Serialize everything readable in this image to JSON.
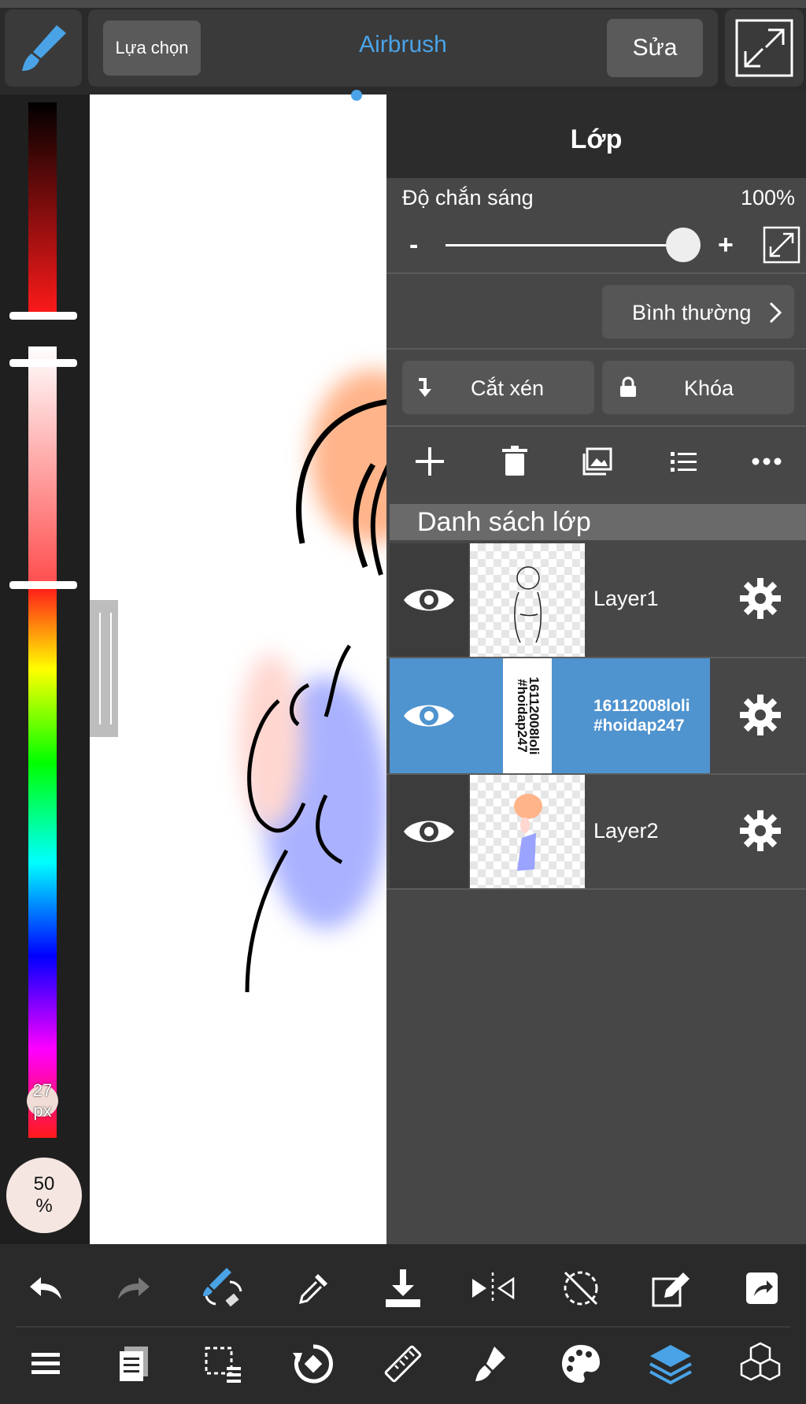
{
  "toolbar": {
    "select_label": "Lựa chọn",
    "tool_name": "Airbrush",
    "edit_label": "Sửa"
  },
  "left_panel": {
    "brush_size": "27\npx",
    "opacity": "50\n%"
  },
  "layer_panel": {
    "title": "Lớp",
    "opacity_label": "Độ chắn sáng",
    "opacity_value": "100%",
    "opacity_level": 1.0,
    "minus": "-",
    "plus": "+",
    "blend_mode": "Bình thường",
    "clip_label": "Cắt xén",
    "lock_label": "Khóa",
    "list_header": "Danh sách lớp",
    "layers": [
      {
        "name": "Layer1",
        "selected": false
      },
      {
        "name": "16112008loli\n#hoidap247",
        "selected": true,
        "thumb_text": "16112008loli\n#hoidap247"
      },
      {
        "name": "Layer2",
        "selected": false
      }
    ]
  },
  "colors": {
    "accent": "#4aa3e6",
    "selected_row": "#4f93cf",
    "panel": "#474747"
  }
}
